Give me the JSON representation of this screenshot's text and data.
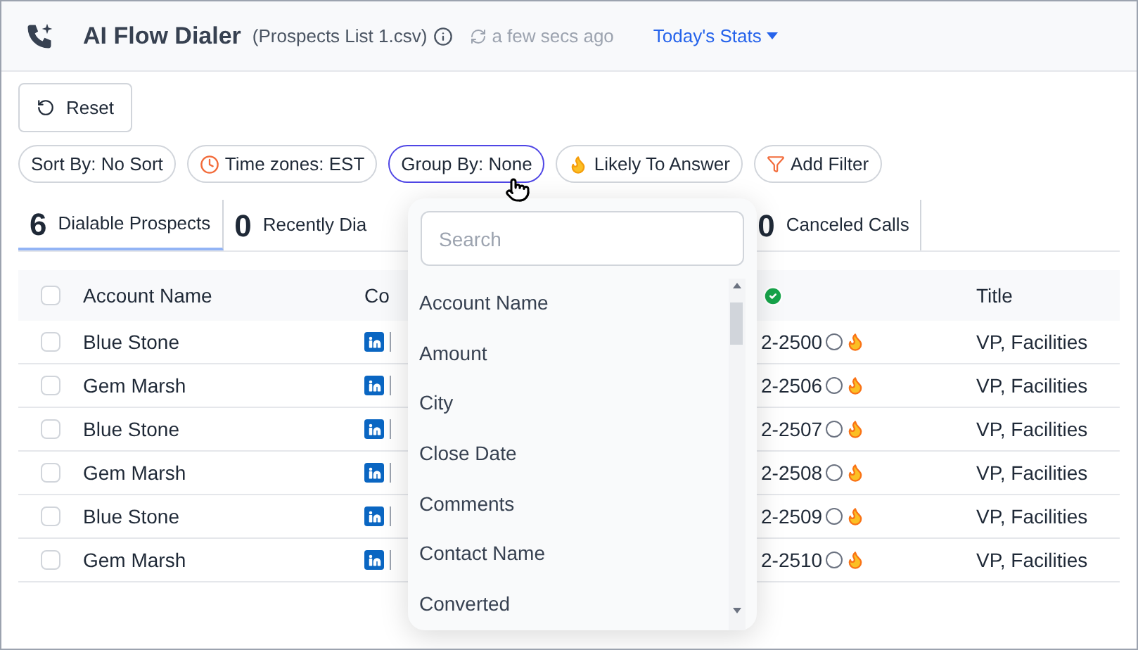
{
  "header": {
    "title": "AI Flow Dialer",
    "file": "(Prospects List 1.csv)",
    "synced": "a few secs ago",
    "stats": "Today's Stats"
  },
  "reset": "Reset",
  "filters": [
    {
      "kind": "plain",
      "label": "Sort By: No Sort",
      "selected": false
    },
    {
      "kind": "clock",
      "label": "Time zones: EST",
      "selected": false
    },
    {
      "kind": "plain",
      "label": "Group By: None",
      "selected": true
    },
    {
      "kind": "fire",
      "label": "Likely To Answer",
      "selected": false
    },
    {
      "kind": "filter",
      "label": "Add Filter",
      "selected": false
    }
  ],
  "tabs": [
    {
      "count": "6",
      "label": "Dialable Prospects",
      "selected": true
    },
    {
      "count": "0",
      "label": "Recently Dia",
      "selected": false
    },
    {
      "count": "0",
      "label": "Canceled Calls",
      "selected": false
    }
  ],
  "table": {
    "select_all_checked": false,
    "columns": [
      "Account Name",
      "Co",
      "Title"
    ],
    "rows": [
      {
        "account": "Blue Stone",
        "phone": "2-2500",
        "title": "VP, Facilities",
        "checked": false
      },
      {
        "account": "Gem Marsh",
        "phone": "2-2506",
        "title": "VP, Facilities",
        "checked": false
      },
      {
        "account": "Blue Stone",
        "phone": "2-2507",
        "title": "VP, Facilities",
        "checked": false
      },
      {
        "account": "Gem Marsh",
        "phone": "2-2508",
        "title": "VP, Facilities",
        "checked": false
      },
      {
        "account": "Blue Stone",
        "phone": "2-2509",
        "title": "VP, Facilities",
        "checked": false
      },
      {
        "account": "Gem Marsh",
        "phone": "2-2510",
        "title": "VP, Facilities",
        "checked": false
      }
    ]
  },
  "dropdown": {
    "placeholder": "Search",
    "items": [
      "Account Name",
      "Amount",
      "City",
      "Close Date",
      "Comments",
      "Contact Name",
      "Converted"
    ]
  }
}
